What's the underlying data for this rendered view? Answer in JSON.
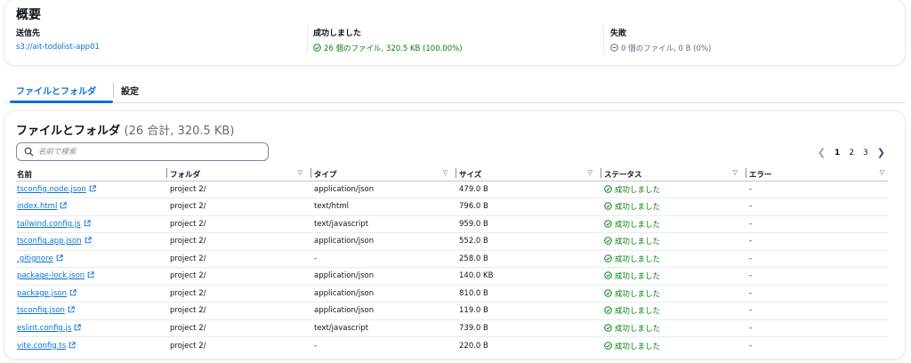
{
  "summary": {
    "title": "概要",
    "destination": {
      "label": "送信先",
      "value": "s3://ait-todolist-app01"
    },
    "succeeded": {
      "label": "成功しました",
      "value": "26 個のファイル, 320.5 KB (100.00%)"
    },
    "failed": {
      "label": "失敗",
      "value": "0 個のファイル, 0 B (0%)"
    }
  },
  "tabs": [
    {
      "label": "ファイルとフォルダ",
      "active": true
    },
    {
      "label": "設定",
      "active": false
    }
  ],
  "files": {
    "title": "ファイルとフォルダ",
    "count": "(26 合計, 320.5 KB)",
    "search_placeholder": "名前で検索",
    "pagination": {
      "pages": [
        "1",
        "2",
        "3"
      ],
      "current": "1"
    },
    "columns": [
      "名前",
      "フォルダ",
      "タイプ",
      "サイズ",
      "ステータス",
      "エラー"
    ],
    "rows": [
      {
        "name": "tsconfig.node.json",
        "folder": "project 2/",
        "type": "application/json",
        "size": "479.0 B",
        "status": "成功しました",
        "error": "-"
      },
      {
        "name": "index.html",
        "folder": "project 2/",
        "type": "text/html",
        "size": "796.0 B",
        "status": "成功しました",
        "error": "-"
      },
      {
        "name": "tailwind.config.js",
        "folder": "project 2/",
        "type": "text/javascript",
        "size": "959.0 B",
        "status": "成功しました",
        "error": "-"
      },
      {
        "name": "tsconfig.app.json",
        "folder": "project 2/",
        "type": "application/json",
        "size": "552.0 B",
        "status": "成功しました",
        "error": "-"
      },
      {
        "name": ".gitignore",
        "folder": "project 2/",
        "type": "-",
        "size": "258.0 B",
        "status": "成功しました",
        "error": "-"
      },
      {
        "name": "package-lock.json",
        "folder": "project 2/",
        "type": "application/json",
        "size": "140.0 KB",
        "status": "成功しました",
        "error": "-"
      },
      {
        "name": "package.json",
        "folder": "project 2/",
        "type": "application/json",
        "size": "810.0 B",
        "status": "成功しました",
        "error": "-"
      },
      {
        "name": "tsconfig.json",
        "folder": "project 2/",
        "type": "application/json",
        "size": "119.0 B",
        "status": "成功しました",
        "error": "-"
      },
      {
        "name": "eslint.config.js",
        "folder": "project 2/",
        "type": "text/javascript",
        "size": "739.0 B",
        "status": "成功しました",
        "error": "-"
      },
      {
        "name": "vite.config.ts",
        "folder": "project 2/",
        "type": "-",
        "size": "220.0 B",
        "status": "成功しました",
        "error": "-"
      }
    ]
  },
  "colors": {
    "accent": "#0972d3",
    "success": "#037f0c",
    "muted": "#5f6b7a"
  },
  "icons": {
    "success": "check-circle-icon",
    "failed": "minus-circle-icon",
    "external": "external-link-icon",
    "search": "search-icon"
  }
}
